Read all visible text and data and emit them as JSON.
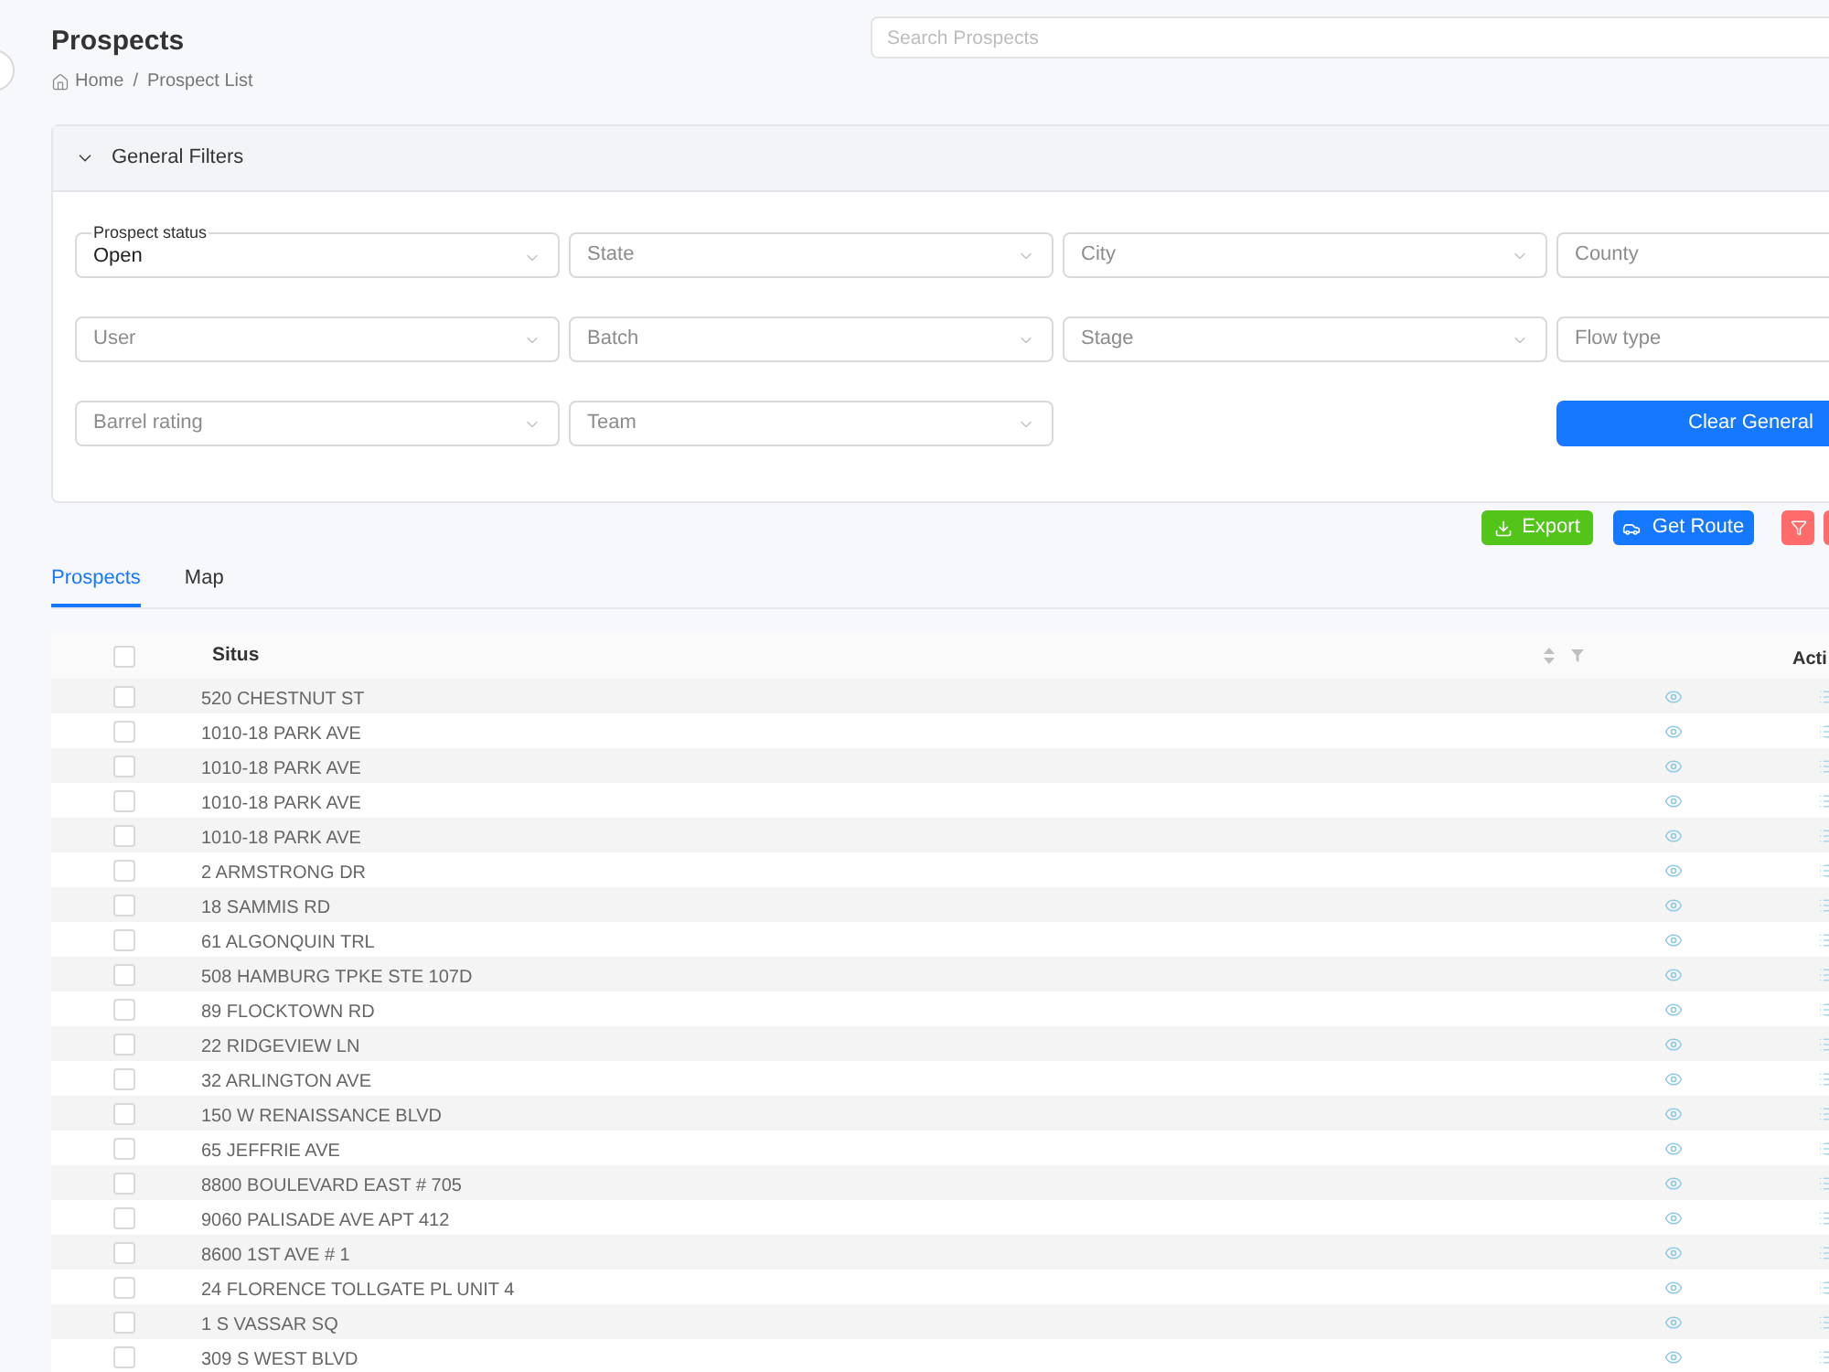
{
  "page": {
    "title": "Prospects",
    "breadcrumb": {
      "items": [
        "Home",
        "Prospect List"
      ],
      "separator": "/"
    }
  },
  "search": {
    "placeholder": "Search Prospects"
  },
  "filters": {
    "title": "General Filters",
    "expanded": true,
    "fields": [
      {
        "label": "Prospect status",
        "value": "Open"
      },
      {
        "placeholder": "State"
      },
      {
        "placeholder": "City"
      },
      {
        "placeholder": "County"
      },
      {
        "placeholder": "User"
      },
      {
        "placeholder": "Batch"
      },
      {
        "placeholder": "Stage"
      },
      {
        "placeholder": "Flow type"
      },
      {
        "placeholder": "Barrel rating"
      },
      {
        "placeholder": "Team"
      }
    ],
    "clear_button": "Clear General"
  },
  "actions": [
    {
      "kind": "export",
      "label": "Export"
    },
    {
      "kind": "route",
      "label": "Get Route"
    },
    {
      "kind": "filter"
    },
    {
      "kind": "extra"
    }
  ],
  "tabs": [
    {
      "label": "Prospects",
      "selected": true
    },
    {
      "label": "Map",
      "selected": false
    }
  ],
  "table": {
    "all_checked": false,
    "columns": [
      {
        "label": "Situs",
        "sortable": true,
        "filterable": true
      },
      {
        "label": "Acti"
      }
    ],
    "rows": [
      {
        "situs": "520 CHESTNUT ST",
        "checked": false
      },
      {
        "situs": "1010-18 PARK AVE",
        "checked": false
      },
      {
        "situs": "1010-18 PARK AVE",
        "checked": false
      },
      {
        "situs": "1010-18 PARK AVE",
        "checked": false
      },
      {
        "situs": "1010-18 PARK AVE",
        "checked": false
      },
      {
        "situs": "2 ARMSTRONG DR",
        "checked": false
      },
      {
        "situs": "18 SAMMIS RD",
        "checked": false
      },
      {
        "situs": "61 ALGONQUIN TRL",
        "checked": false
      },
      {
        "situs": "508 HAMBURG TPKE STE 107D",
        "checked": false
      },
      {
        "situs": "89 FLOCKTOWN RD",
        "checked": false
      },
      {
        "situs": "22 RIDGEVIEW LN",
        "checked": false
      },
      {
        "situs": "32 ARLINGTON AVE",
        "checked": false
      },
      {
        "situs": "150 W RENAISSANCE BLVD",
        "checked": false
      },
      {
        "situs": "65 JEFFRIE AVE",
        "checked": false
      },
      {
        "situs": "8800 BOULEVARD EAST # 705",
        "checked": false
      },
      {
        "situs": "9060 PALISADE AVE APT 412",
        "checked": false
      },
      {
        "situs": "8600 1ST AVE # 1",
        "checked": false
      },
      {
        "situs": "24 FLORENCE TOLLGATE PL UNIT 4",
        "checked": false
      },
      {
        "situs": "1 S VASSAR SQ",
        "checked": false
      },
      {
        "situs": "309 S WEST BLVD",
        "checked": false
      }
    ]
  }
}
